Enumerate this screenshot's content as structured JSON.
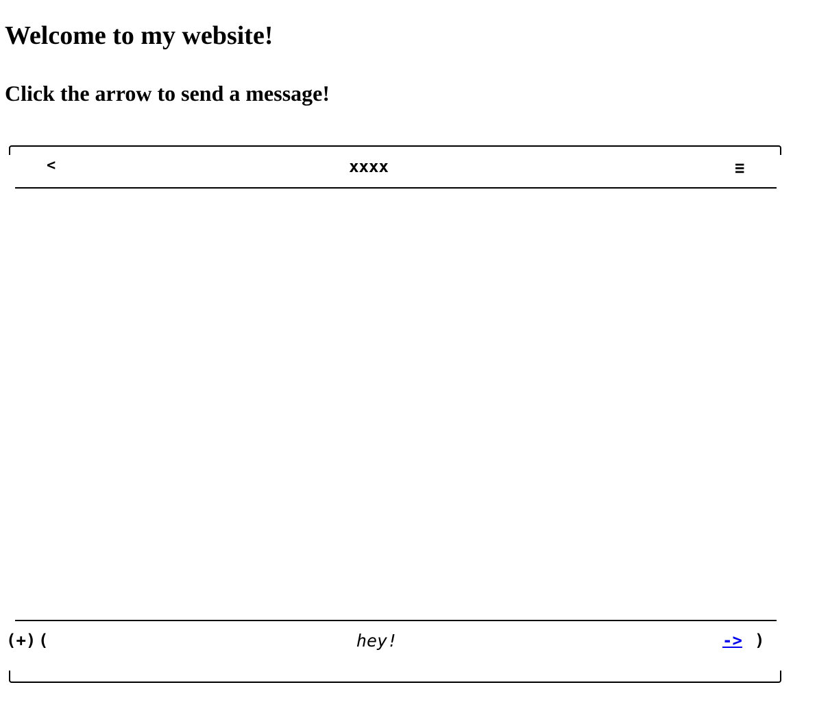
{
  "page": {
    "heading": "Welcome to my website!",
    "subheading": "Click the arrow to send a message!"
  },
  "chat": {
    "header": {
      "back_label": "<",
      "title": "xxxx",
      "menu_label": "≡"
    },
    "footer": {
      "add_label": "(+)",
      "open_paren": "(",
      "input_value": "hey!",
      "send_label": "->",
      "close_paren": ")"
    }
  },
  "colors": {
    "link": "#0000ee",
    "text": "#000000",
    "background": "#ffffff"
  },
  "icons": {
    "back": "back-arrow-icon",
    "menu": "hamburger-menu-icon",
    "add": "add-icon",
    "send": "send-arrow-icon"
  }
}
